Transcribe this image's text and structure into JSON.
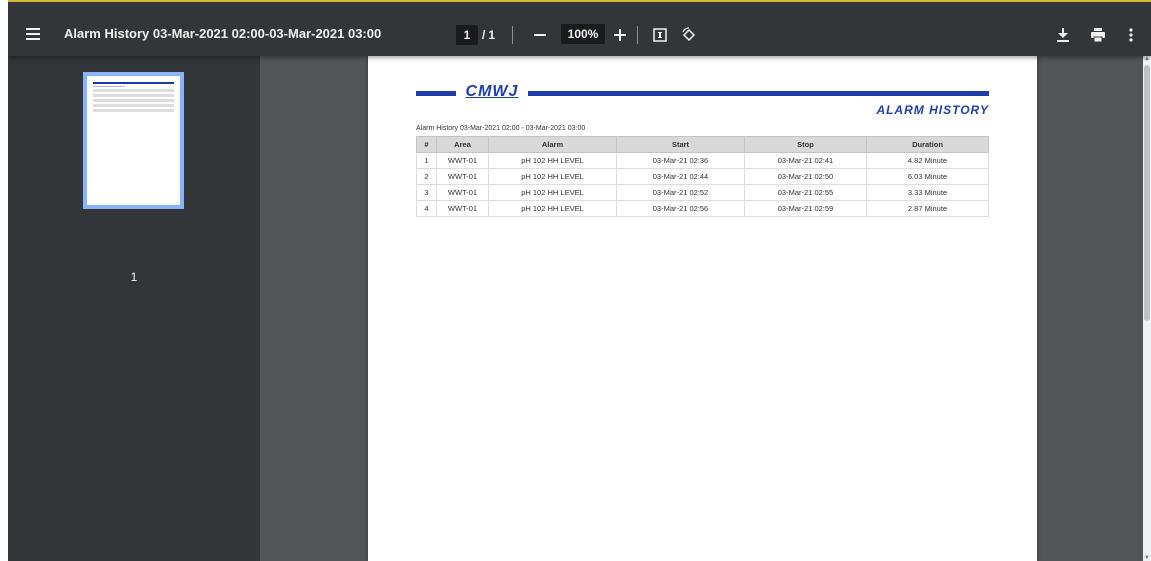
{
  "toolbar": {
    "title": "Alarm History 03-Mar-2021 02:00-03-Mar-2021 03:00",
    "current_page": "1",
    "page_separator": "/",
    "total_pages": "1",
    "zoom": "100%",
    "icons": [
      "menu-icon",
      "zoom-out-icon",
      "zoom-in-icon",
      "fit-page-icon",
      "rotate-icon",
      "download-icon",
      "print-icon",
      "more-icon"
    ]
  },
  "sidebar": {
    "thumbnail_label": "1"
  },
  "report": {
    "logo": "CMWJ",
    "title": "ALARM HISTORY",
    "subtitle": "Alarm History 03-Mar-2021 02:00 - 03-Mar-2021 03:00",
    "columns": [
      "#",
      "Area",
      "Alarm",
      "Start",
      "Stop",
      "Duration"
    ],
    "rows": [
      [
        "1",
        "WWT-01",
        "pH 102 HH LEVEL",
        "03-Mar-21 02:36",
        "03-Mar-21 02:41",
        "4.82 Minute"
      ],
      [
        "2",
        "WWT-01",
        "pH 102 HH LEVEL",
        "03-Mar-21 02:44",
        "03-Mar-21 02:50",
        "6.03 Minute"
      ],
      [
        "3",
        "WWT-01",
        "pH 102 HH LEVEL",
        "03-Mar-21 02:52",
        "03-Mar-21 02:55",
        "3.33 Minute"
      ],
      [
        "4",
        "WWT-01",
        "pH 102 HH LEVEL",
        "03-Mar-21 02:56",
        "03-Mar-21 02:59",
        "2.87 Minute"
      ]
    ]
  },
  "colors": {
    "toolbar_bg": "#323639",
    "viewer_bg": "#525659",
    "brand_blue": "#1f3fa6",
    "thumb_highlight": "#8ab4f8"
  }
}
